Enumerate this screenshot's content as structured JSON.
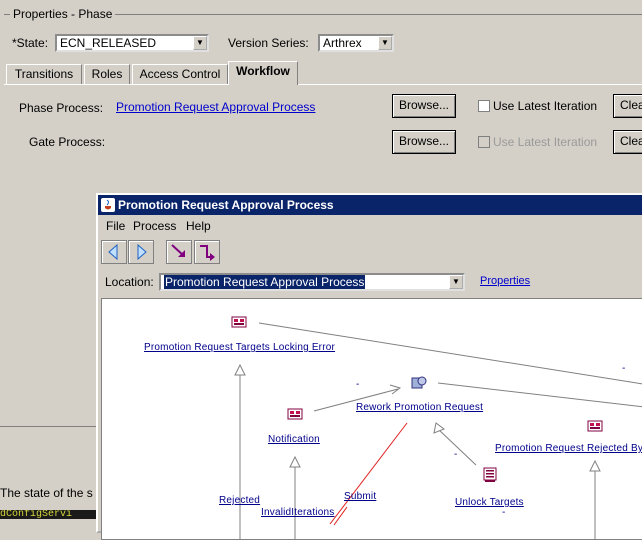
{
  "panel": {
    "title": "Properties - Phase",
    "state_label": "*State:",
    "state_value": "ECN_RELEASED",
    "version_label": "Version Series:",
    "version_value": "Arthrex"
  },
  "tabs": [
    {
      "label": "Transitions"
    },
    {
      "label": "Roles"
    },
    {
      "label": "Access Control"
    },
    {
      "label": "Workflow"
    }
  ],
  "workflow": {
    "phase_label": "Phase Process:",
    "phase_value": "Promotion Request Approval Process",
    "gate_label": "Gate Process:",
    "browse_label": "Browse...",
    "latest_label": "Use Latest Iteration",
    "clear_label": "Clea"
  },
  "status_text": "The state of the s",
  "console_text": "dConfigServi",
  "dialog": {
    "title": "Promotion Request Approval Process",
    "menu": [
      "File",
      "Process",
      "Help"
    ],
    "location_label": "Location:",
    "location_value": "Promotion Request Approval Process",
    "properties_link": "Properties"
  },
  "diagram": {
    "nodes": [
      {
        "label": "Promotion Request Targets Locking Error",
        "icon": "activity-icon"
      },
      {
        "label": "Notification",
        "icon": "activity-icon"
      },
      {
        "label": "Rework Promotion Request",
        "icon": "task-icon"
      },
      {
        "label": "Promotion Request Rejected By",
        "icon": "activity-icon"
      },
      {
        "label": "Unlock Targets",
        "icon": "robot-icon"
      }
    ],
    "links": [
      "Rejected",
      "InvalidIterations",
      "Submit"
    ],
    "dashes": [
      "-",
      "-",
      "-",
      "-"
    ]
  }
}
